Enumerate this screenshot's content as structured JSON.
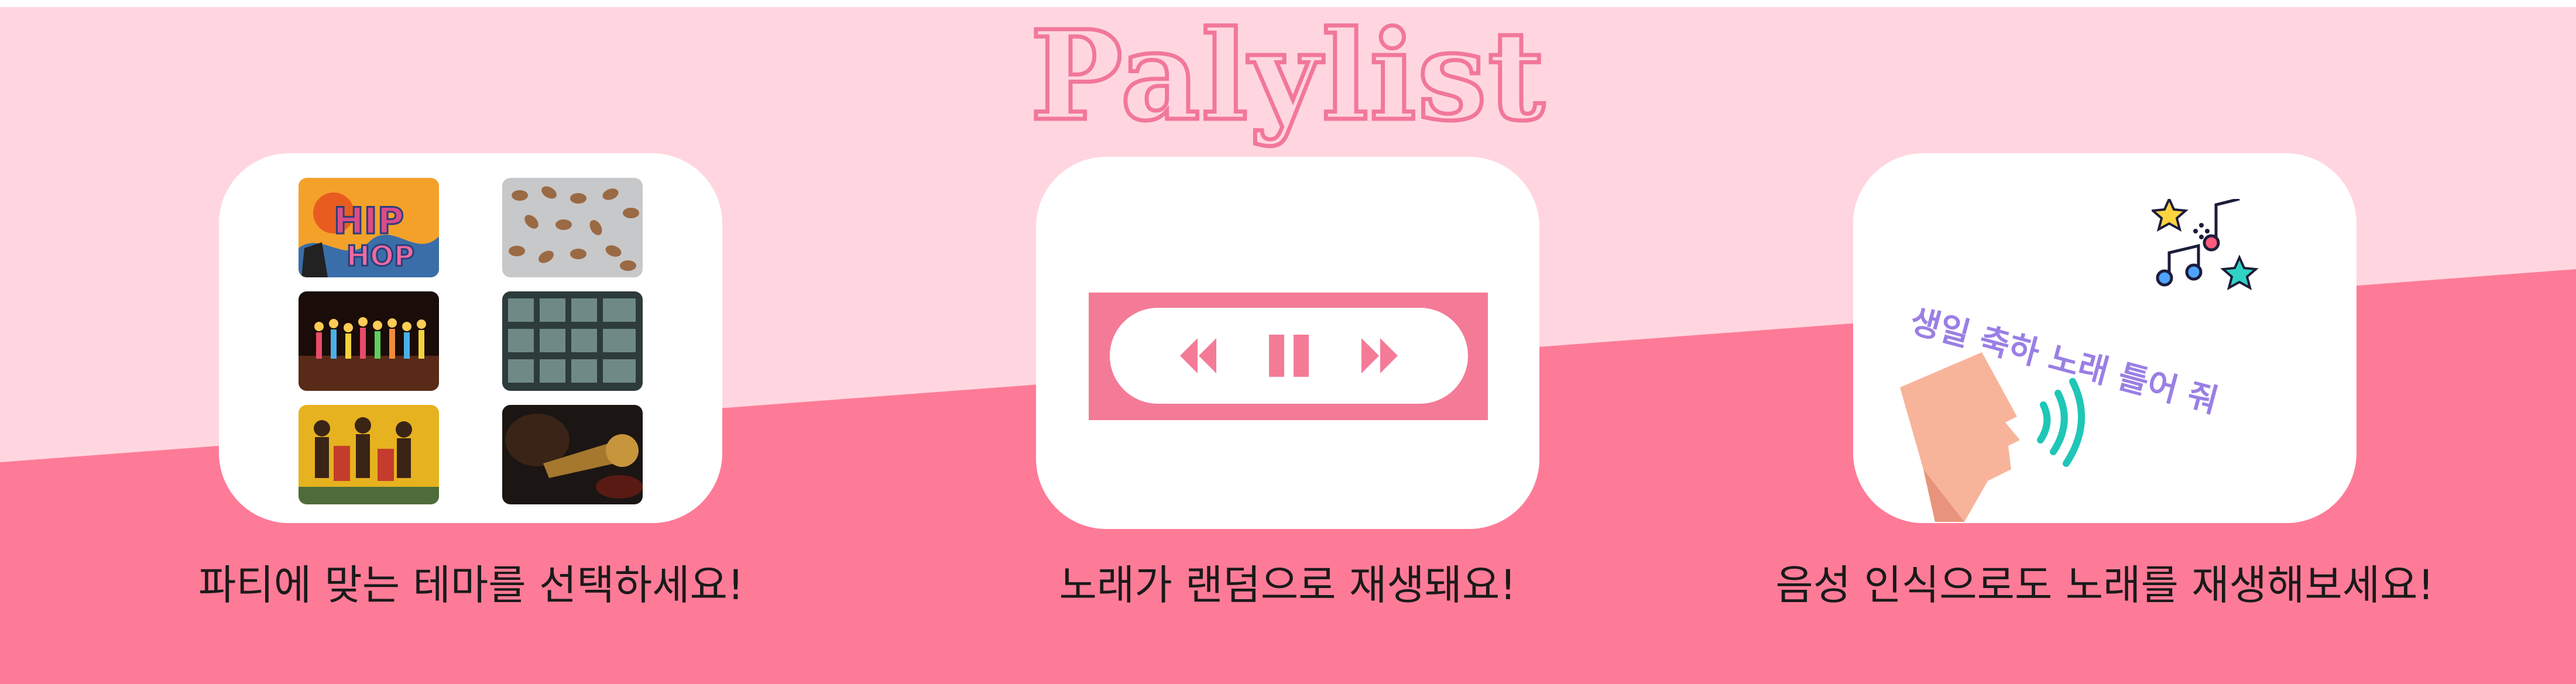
{
  "header": {
    "title": "Palylist"
  },
  "colors": {
    "top_bg": "#ffd6df",
    "bottom_bg": "#fe7b97",
    "accent": "#f47b97",
    "voice_text": "#9a7fe4"
  },
  "cards": [
    {
      "caption": "파티에 맞는 테마를 선택하세요!",
      "thumbnails": [
        "hiphop-theme",
        "nuts-theme",
        "birthday-theme",
        "records-theme",
        "dance-theme",
        "trumpet-theme"
      ]
    },
    {
      "caption": "노래가 랜덤으로 재생돼요!",
      "controls": [
        "rewind-icon",
        "pause-icon",
        "fast-forward-icon"
      ]
    },
    {
      "caption": "음성 인식으로도 노래를 재생해보세요!",
      "voice_command": "생일 축하 노래 틀어 줘",
      "icons": [
        "music-notes-icon",
        "speaking-head-icon"
      ]
    }
  ]
}
